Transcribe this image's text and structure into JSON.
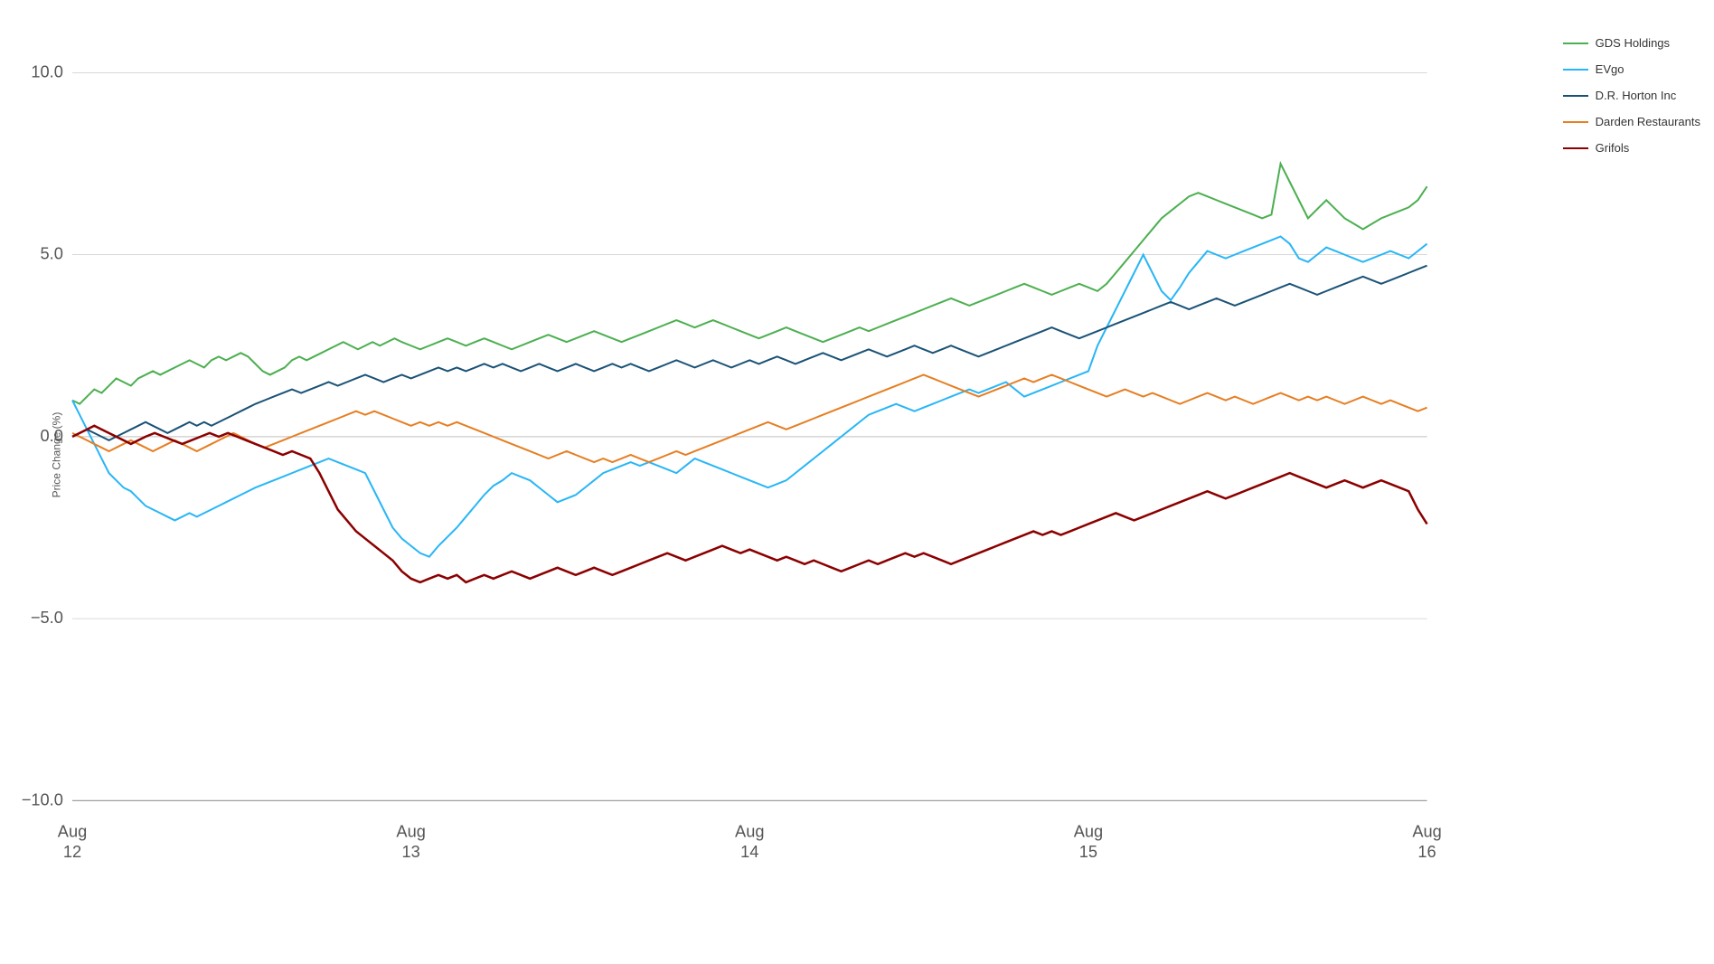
{
  "chart": {
    "title": "Price Change (%)",
    "y_axis": {
      "labels": [
        "10.0",
        "5.0",
        "0.0",
        "-5.0",
        "-10.0"
      ],
      "values": [
        10,
        5,
        0,
        -5,
        -10
      ]
    },
    "x_axis": {
      "labels": [
        "Aug 12",
        "Aug 13",
        "Aug 14",
        "Aug 15",
        "Aug 16"
      ]
    },
    "series": [
      {
        "name": "GDS Holdings",
        "color": "#4caf50",
        "dash": "none"
      },
      {
        "name": "EVgo",
        "color": "#29b6f6",
        "dash": "none"
      },
      {
        "name": "D.R. Horton Inc",
        "color": "#1a5276",
        "dash": "none"
      },
      {
        "name": "Darden Restaurants",
        "color": "#e67e22",
        "dash": "none"
      },
      {
        "name": "Grifols",
        "color": "#8b0000",
        "dash": "none"
      }
    ]
  },
  "legend": {
    "items": [
      {
        "label": "GDS Holdings",
        "color": "#4caf50"
      },
      {
        "label": "EVgo",
        "color": "#29b6f6"
      },
      {
        "label": "D.R. Horton Inc",
        "color": "#1a5276"
      },
      {
        "label": "Darden Restaurants",
        "color": "#e67e22"
      },
      {
        "label": "Grifols",
        "color": "#8b0000"
      }
    ]
  }
}
